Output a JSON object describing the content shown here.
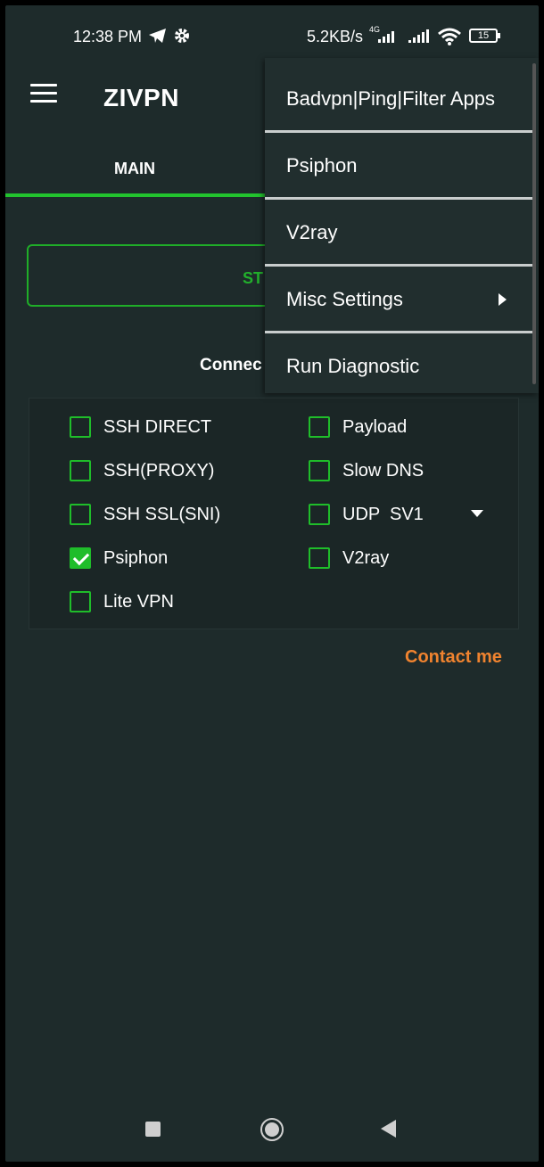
{
  "status_bar": {
    "time": "12:38 PM",
    "speed": "5.2KB/s",
    "network": "4G",
    "battery": "15"
  },
  "app_bar": {
    "title": "ZIVPN"
  },
  "tabs": {
    "main": "MAIN"
  },
  "start_button": {
    "label": "ST"
  },
  "connection_label": "Connec",
  "options": [
    {
      "label": "SSH DIRECT",
      "checked": false
    },
    {
      "label": "SSH(PROXY)",
      "checked": false
    },
    {
      "label": "SSH SSL(SNI)",
      "checked": false
    },
    {
      "label": "Psiphon",
      "checked": true
    },
    {
      "label": "Lite VPN",
      "checked": false
    },
    {
      "label": "Payload",
      "checked": false
    },
    {
      "label": "Slow DNS",
      "checked": false
    },
    {
      "label": "UDP  SV1",
      "checked": false
    },
    {
      "label": "V2ray",
      "checked": false
    }
  ],
  "contact_link": "Contact me",
  "menu": {
    "items": [
      {
        "label": "Badvpn|Ping|Filter Apps"
      },
      {
        "label": "Psiphon"
      },
      {
        "label": "V2ray"
      },
      {
        "label": "Misc Settings"
      },
      {
        "label": "Run Diagnostic"
      }
    ]
  },
  "colors": {
    "accent": "#22c32e",
    "contact": "#f0832f",
    "background": "#1e2b2b"
  },
  "icons": [
    "telegram-icon",
    "gear-icon",
    "signal-icon",
    "wifi-icon",
    "battery-icon",
    "hamburger-menu-icon",
    "checkbox-icon",
    "dropdown-arrow-icon",
    "submenu-arrow-icon",
    "nav-recents-icon",
    "nav-home-icon",
    "nav-back-icon"
  ]
}
